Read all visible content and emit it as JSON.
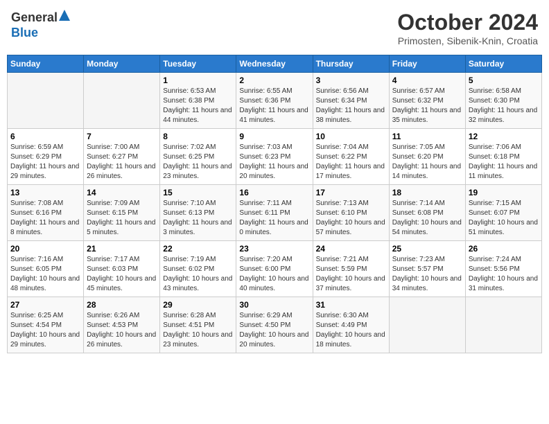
{
  "header": {
    "logo_general": "General",
    "logo_blue": "Blue",
    "title": "October 2024",
    "subtitle": "Primosten, Sibenik-Knin, Croatia"
  },
  "weekdays": [
    "Sunday",
    "Monday",
    "Tuesday",
    "Wednesday",
    "Thursday",
    "Friday",
    "Saturday"
  ],
  "weeks": [
    [
      {
        "day": "",
        "empty": true
      },
      {
        "day": "",
        "empty": true
      },
      {
        "day": "1",
        "sunrise": "Sunrise: 6:53 AM",
        "sunset": "Sunset: 6:38 PM",
        "daylight": "Daylight: 11 hours and 44 minutes."
      },
      {
        "day": "2",
        "sunrise": "Sunrise: 6:55 AM",
        "sunset": "Sunset: 6:36 PM",
        "daylight": "Daylight: 11 hours and 41 minutes."
      },
      {
        "day": "3",
        "sunrise": "Sunrise: 6:56 AM",
        "sunset": "Sunset: 6:34 PM",
        "daylight": "Daylight: 11 hours and 38 minutes."
      },
      {
        "day": "4",
        "sunrise": "Sunrise: 6:57 AM",
        "sunset": "Sunset: 6:32 PM",
        "daylight": "Daylight: 11 hours and 35 minutes."
      },
      {
        "day": "5",
        "sunrise": "Sunrise: 6:58 AM",
        "sunset": "Sunset: 6:30 PM",
        "daylight": "Daylight: 11 hours and 32 minutes."
      }
    ],
    [
      {
        "day": "6",
        "sunrise": "Sunrise: 6:59 AM",
        "sunset": "Sunset: 6:29 PM",
        "daylight": "Daylight: 11 hours and 29 minutes."
      },
      {
        "day": "7",
        "sunrise": "Sunrise: 7:00 AM",
        "sunset": "Sunset: 6:27 PM",
        "daylight": "Daylight: 11 hours and 26 minutes."
      },
      {
        "day": "8",
        "sunrise": "Sunrise: 7:02 AM",
        "sunset": "Sunset: 6:25 PM",
        "daylight": "Daylight: 11 hours and 23 minutes."
      },
      {
        "day": "9",
        "sunrise": "Sunrise: 7:03 AM",
        "sunset": "Sunset: 6:23 PM",
        "daylight": "Daylight: 11 hours and 20 minutes."
      },
      {
        "day": "10",
        "sunrise": "Sunrise: 7:04 AM",
        "sunset": "Sunset: 6:22 PM",
        "daylight": "Daylight: 11 hours and 17 minutes."
      },
      {
        "day": "11",
        "sunrise": "Sunrise: 7:05 AM",
        "sunset": "Sunset: 6:20 PM",
        "daylight": "Daylight: 11 hours and 14 minutes."
      },
      {
        "day": "12",
        "sunrise": "Sunrise: 7:06 AM",
        "sunset": "Sunset: 6:18 PM",
        "daylight": "Daylight: 11 hours and 11 minutes."
      }
    ],
    [
      {
        "day": "13",
        "sunrise": "Sunrise: 7:08 AM",
        "sunset": "Sunset: 6:16 PM",
        "daylight": "Daylight: 11 hours and 8 minutes."
      },
      {
        "day": "14",
        "sunrise": "Sunrise: 7:09 AM",
        "sunset": "Sunset: 6:15 PM",
        "daylight": "Daylight: 11 hours and 5 minutes."
      },
      {
        "day": "15",
        "sunrise": "Sunrise: 7:10 AM",
        "sunset": "Sunset: 6:13 PM",
        "daylight": "Daylight: 11 hours and 3 minutes."
      },
      {
        "day": "16",
        "sunrise": "Sunrise: 7:11 AM",
        "sunset": "Sunset: 6:11 PM",
        "daylight": "Daylight: 11 hours and 0 minutes."
      },
      {
        "day": "17",
        "sunrise": "Sunrise: 7:13 AM",
        "sunset": "Sunset: 6:10 PM",
        "daylight": "Daylight: 10 hours and 57 minutes."
      },
      {
        "day": "18",
        "sunrise": "Sunrise: 7:14 AM",
        "sunset": "Sunset: 6:08 PM",
        "daylight": "Daylight: 10 hours and 54 minutes."
      },
      {
        "day": "19",
        "sunrise": "Sunrise: 7:15 AM",
        "sunset": "Sunset: 6:07 PM",
        "daylight": "Daylight: 10 hours and 51 minutes."
      }
    ],
    [
      {
        "day": "20",
        "sunrise": "Sunrise: 7:16 AM",
        "sunset": "Sunset: 6:05 PM",
        "daylight": "Daylight: 10 hours and 48 minutes."
      },
      {
        "day": "21",
        "sunrise": "Sunrise: 7:17 AM",
        "sunset": "Sunset: 6:03 PM",
        "daylight": "Daylight: 10 hours and 45 minutes."
      },
      {
        "day": "22",
        "sunrise": "Sunrise: 7:19 AM",
        "sunset": "Sunset: 6:02 PM",
        "daylight": "Daylight: 10 hours and 43 minutes."
      },
      {
        "day": "23",
        "sunrise": "Sunrise: 7:20 AM",
        "sunset": "Sunset: 6:00 PM",
        "daylight": "Daylight: 10 hours and 40 minutes."
      },
      {
        "day": "24",
        "sunrise": "Sunrise: 7:21 AM",
        "sunset": "Sunset: 5:59 PM",
        "daylight": "Daylight: 10 hours and 37 minutes."
      },
      {
        "day": "25",
        "sunrise": "Sunrise: 7:23 AM",
        "sunset": "Sunset: 5:57 PM",
        "daylight": "Daylight: 10 hours and 34 minutes."
      },
      {
        "day": "26",
        "sunrise": "Sunrise: 7:24 AM",
        "sunset": "Sunset: 5:56 PM",
        "daylight": "Daylight: 10 hours and 31 minutes."
      }
    ],
    [
      {
        "day": "27",
        "sunrise": "Sunrise: 6:25 AM",
        "sunset": "Sunset: 4:54 PM",
        "daylight": "Daylight: 10 hours and 29 minutes."
      },
      {
        "day": "28",
        "sunrise": "Sunrise: 6:26 AM",
        "sunset": "Sunset: 4:53 PM",
        "daylight": "Daylight: 10 hours and 26 minutes."
      },
      {
        "day": "29",
        "sunrise": "Sunrise: 6:28 AM",
        "sunset": "Sunset: 4:51 PM",
        "daylight": "Daylight: 10 hours and 23 minutes."
      },
      {
        "day": "30",
        "sunrise": "Sunrise: 6:29 AM",
        "sunset": "Sunset: 4:50 PM",
        "daylight": "Daylight: 10 hours and 20 minutes."
      },
      {
        "day": "31",
        "sunrise": "Sunrise: 6:30 AM",
        "sunset": "Sunset: 4:49 PM",
        "daylight": "Daylight: 10 hours and 18 minutes."
      },
      {
        "day": "",
        "empty": true
      },
      {
        "day": "",
        "empty": true
      }
    ]
  ]
}
